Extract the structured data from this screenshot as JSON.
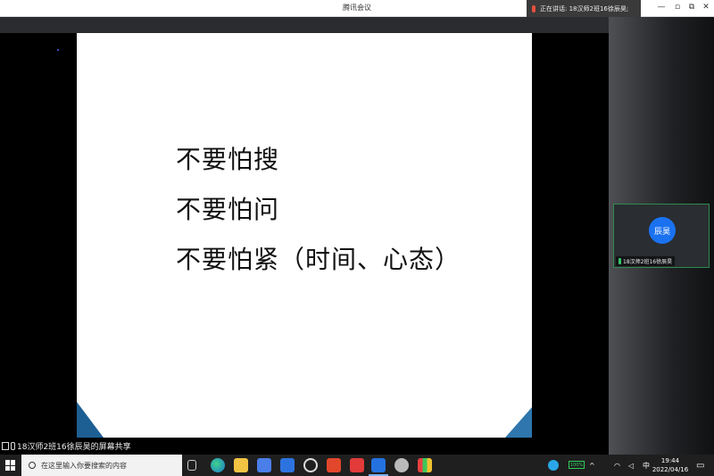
{
  "window": {
    "title": "腾讯会议",
    "speaking_indicator": "正在讲话: 18汉师2班16徐辰昊;",
    "controls": {
      "minimize": "—",
      "restore": "▫",
      "maximize": "⧉",
      "close": "✕"
    }
  },
  "slide": {
    "lines": [
      "不要怕搜",
      "不要怕问",
      "不要怕紧（时间、心态）"
    ]
  },
  "participant": {
    "avatar_text": "辰昊",
    "name": "18汉师2班16徐辰昊",
    "mic_icon": "mic-icon",
    "border_color": "#2f8a4f"
  },
  "share_bar": {
    "text": "18汉师2班16徐辰昊的屏幕共享",
    "icons": [
      "screen-share-icon",
      "mic-icon"
    ]
  },
  "taskbar": {
    "search_placeholder": "在这里输入你要搜索的内容",
    "battery_text": "100%",
    "ime": "中",
    "time": "19:44",
    "date": "2022/04/16",
    "apps": [
      "task-view-icon",
      "edge-icon",
      "file-explorer-icon",
      "store-icon",
      "app-icon",
      "circle-app-icon",
      "office-icon",
      "wps-icon",
      "tencent-meeting-icon",
      "avatar-app-icon",
      "grid-app-icon"
    ]
  },
  "colors": {
    "avatar": "#1a72f0",
    "slide_accent": "#2e76ad",
    "battery": "#2fce5a"
  }
}
